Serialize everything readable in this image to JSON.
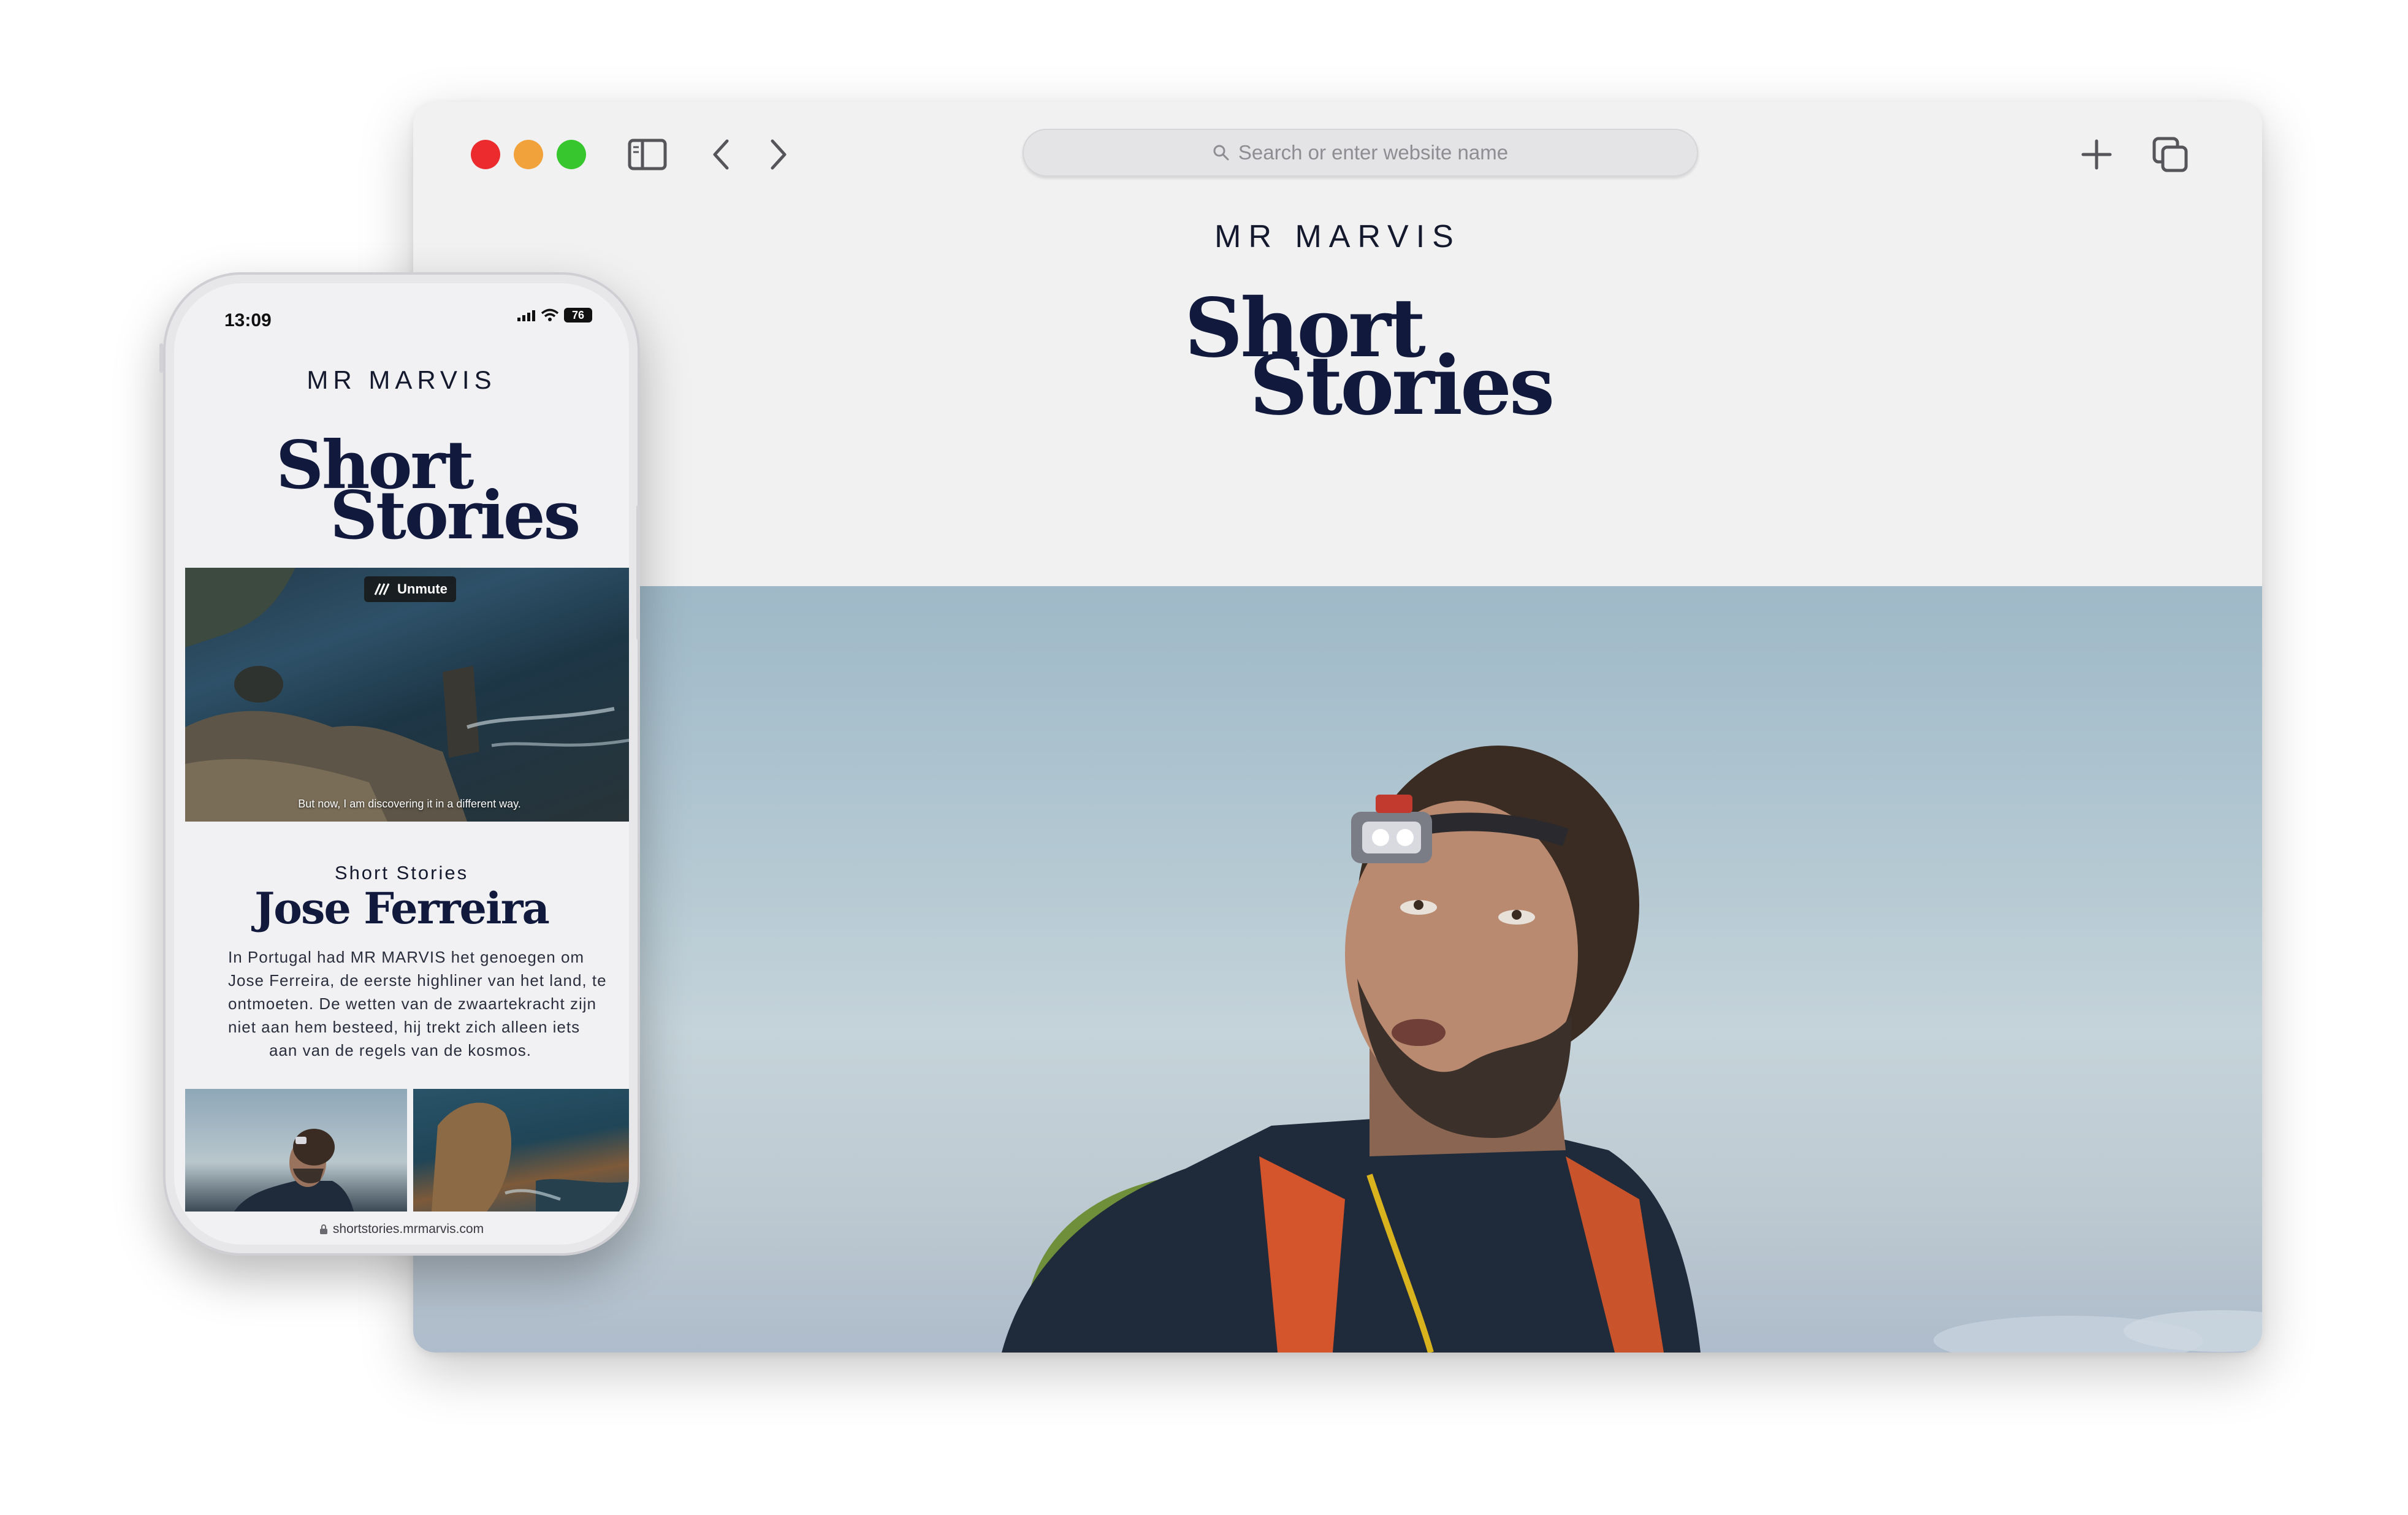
{
  "browser": {
    "search_placeholder": "Search or enter website name",
    "icons": [
      "sidebar-icon",
      "back-icon",
      "forward-icon",
      "search-icon",
      "new-tab-icon",
      "tabs-overview-icon"
    ]
  },
  "site": {
    "brand": "MR MARVIS",
    "logo_line1": "Short",
    "logo_line2": "Stories"
  },
  "phone": {
    "time": "13:09",
    "battery": "76",
    "brand": "MR MARVIS",
    "logo_line1": "Short",
    "logo_line2": "Stories",
    "video": {
      "unmute_label": "Unmute",
      "caption": "But now, I am discovering it in a different way."
    },
    "kicker": "Short Stories",
    "title": "Jose Ferreira",
    "description_lines": [
      "In Portugal had MR MARVIS het genoegen om",
      "Jose Ferreira, de eerste highliner van het land, te",
      "ontmoeten. De wetten van de zwaartekracht zijn",
      "niet aan hem besteed, hij trekt zich alleen iets",
      "aan van de regels van de kosmos."
    ],
    "url": "shortstories.mrmarvis.com"
  },
  "colors": {
    "navy": "#111a3c",
    "traffic_red": "#ec2b2e",
    "traffic_yellow": "#f2a23a",
    "traffic_green": "#37c62e",
    "sky": "#b3c8d2"
  }
}
